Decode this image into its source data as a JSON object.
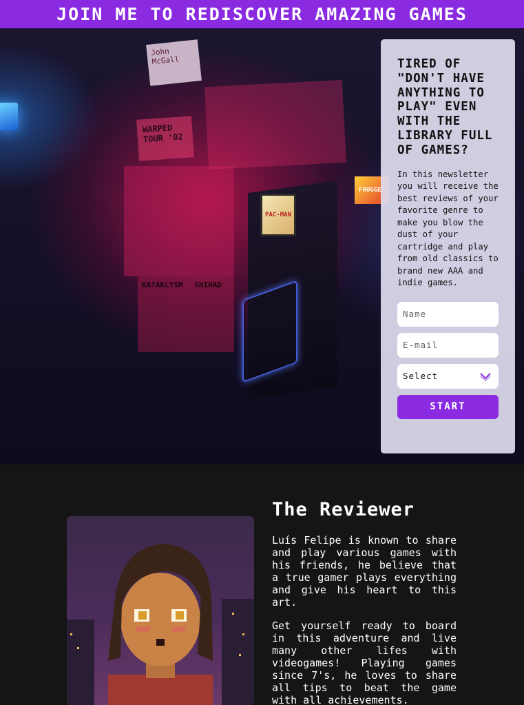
{
  "banner": {
    "title": "JOIN ME TO REDISCOVER AMAZING GAMES"
  },
  "hero": {
    "decor_text": [
      "John McGall",
      "WARPED TOUR '02",
      "PAC-MAN",
      "FROGGER",
      "KATAKLYSM",
      "SHIHAD"
    ]
  },
  "signup": {
    "heading": "TIRED OF \"DON'T HAVE ANYTHING TO PLAY\" EVEN WITH THE LIBRARY FULL OF GAMES?",
    "description": "In this newsletter you will receive the best reviews of your favorite genre to make you blow the dust of your cartridge and play from old classics to brand new AAA and indie games.",
    "name_placeholder": "Name",
    "email_placeholder": "E-mail",
    "select_value": "Select",
    "submit_label": "START"
  },
  "about": {
    "title": "The Reviewer",
    "paragraphs": [
      "Luís Felipe is known to share and play various games with his friends, he believe that a true gamer plays everything and give his heart to this art.",
      "Get yourself ready to board in this adventure and live many other lifes with videogames! Playing games since 7's, he loves to share all tips to beat the game with all achievements."
    ]
  },
  "colors": {
    "accent": "#8a2be2",
    "card_bg": "#dedcee",
    "page_bg": "#151515"
  },
  "icons": {
    "select_chevron": "chevron-down-icon"
  }
}
